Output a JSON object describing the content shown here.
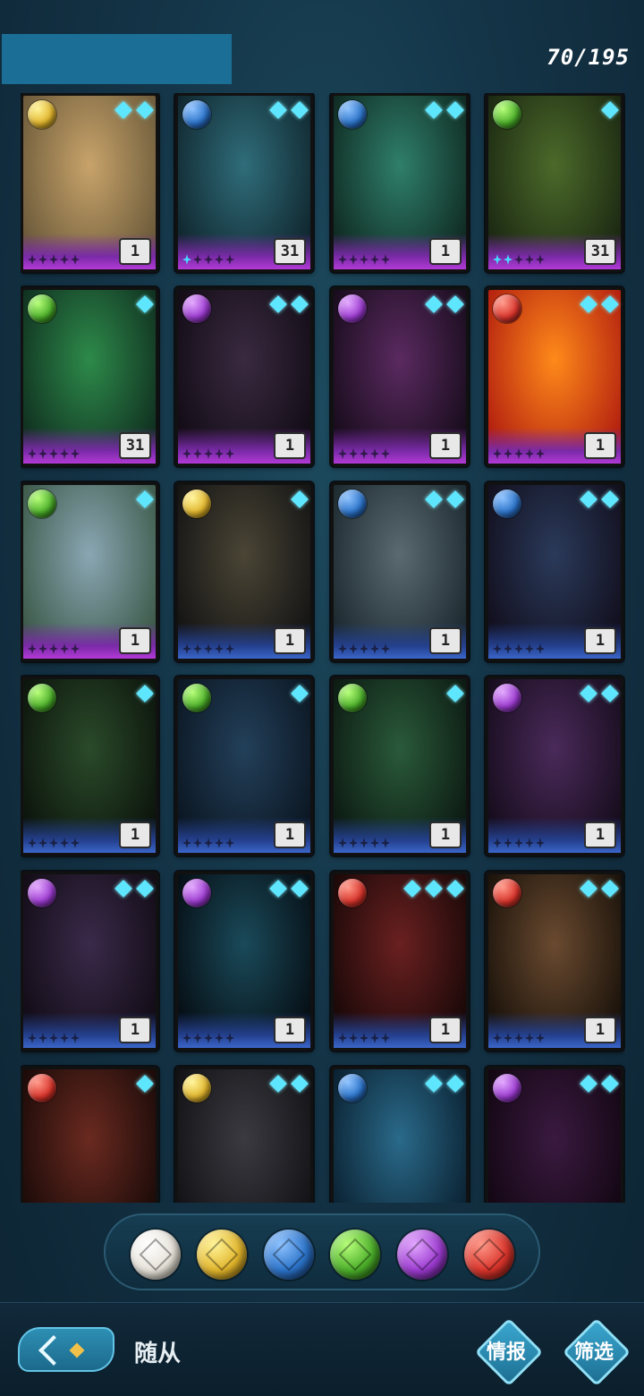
{
  "header": {
    "counter": "70/195"
  },
  "cards": [
    {
      "element": "light",
      "diamonds": 2,
      "count": "1",
      "stars_lit": 0,
      "rarity": "purple",
      "art": [
        "#c8a36a",
        "#6b5a3a"
      ]
    },
    {
      "element": "water",
      "diamonds": 2,
      "count": "31",
      "stars_lit": 1,
      "rarity": "purple",
      "art": [
        "#2f6d7a",
        "#10262e"
      ]
    },
    {
      "element": "water",
      "diamonds": 2,
      "count": "1",
      "stars_lit": 0,
      "rarity": "purple",
      "art": [
        "#2f7f6b",
        "#0f2a22"
      ]
    },
    {
      "element": "nature",
      "diamonds": 1,
      "count": "31",
      "stars_lit": 2,
      "rarity": "purple",
      "art": [
        "#4c6a2a",
        "#1b2812"
      ]
    },
    {
      "element": "nature",
      "diamonds": 1,
      "count": "31",
      "stars_lit": 0,
      "rarity": "purple",
      "art": [
        "#2d8a4a",
        "#103020"
      ]
    },
    {
      "element": "dark",
      "diamonds": 2,
      "count": "1",
      "stars_lit": 0,
      "rarity": "purple",
      "art": [
        "#3a2a40",
        "#120c16"
      ]
    },
    {
      "element": "dark",
      "diamonds": 2,
      "count": "1",
      "stars_lit": 0,
      "rarity": "purple",
      "art": [
        "#5a2a60",
        "#180c1c"
      ]
    },
    {
      "element": "fire",
      "diamonds": 2,
      "count": "1",
      "stars_lit": 0,
      "rarity": "purple",
      "art": [
        "#ff8a1a",
        "#b3200f"
      ]
    },
    {
      "element": "nature",
      "diamonds": 1,
      "count": "1",
      "stars_lit": 0,
      "rarity": "purple",
      "art": [
        "#8aa6b3",
        "#3d5a4a"
      ]
    },
    {
      "element": "light",
      "diamonds": 1,
      "count": "1",
      "stars_lit": 0,
      "rarity": "blue",
      "art": [
        "#4a4535",
        "#141414"
      ]
    },
    {
      "element": "water",
      "diamonds": 2,
      "count": "1",
      "stars_lit": 0,
      "rarity": "blue",
      "art": [
        "#5a6a70",
        "#1c2a30"
      ]
    },
    {
      "element": "water",
      "diamonds": 2,
      "count": "1",
      "stars_lit": 0,
      "rarity": "blue",
      "art": [
        "#2a3a5a",
        "#120f1e"
      ]
    },
    {
      "element": "nature",
      "diamonds": 1,
      "count": "1",
      "stars_lit": 0,
      "rarity": "blue",
      "art": [
        "#2a4a2a",
        "#0c140c"
      ]
    },
    {
      "element": "nature",
      "diamonds": 1,
      "count": "1",
      "stars_lit": 0,
      "rarity": "blue",
      "art": [
        "#23405a",
        "#0b1622"
      ]
    },
    {
      "element": "nature",
      "diamonds": 1,
      "count": "1",
      "stars_lit": 0,
      "rarity": "blue",
      "art": [
        "#2a5a3a",
        "#0c1a12"
      ]
    },
    {
      "element": "dark",
      "diamonds": 2,
      "count": "1",
      "stars_lit": 0,
      "rarity": "blue",
      "art": [
        "#4a2a5a",
        "#160c1c"
      ]
    },
    {
      "element": "dark",
      "diamonds": 2,
      "count": "1",
      "stars_lit": 0,
      "rarity": "blue",
      "art": [
        "#3a2a4a",
        "#120c16"
      ]
    },
    {
      "element": "dark",
      "diamonds": 2,
      "count": "1",
      "stars_lit": 0,
      "rarity": "blue",
      "art": [
        "#1a4a5a",
        "#060e14"
      ]
    },
    {
      "element": "fire",
      "diamonds": 3,
      "count": "1",
      "stars_lit": 0,
      "rarity": "blue",
      "art": [
        "#6a2020",
        "#1a0808"
      ]
    },
    {
      "element": "fire",
      "diamonds": 2,
      "count": "1",
      "stars_lit": 0,
      "rarity": "blue",
      "art": [
        "#6a4a30",
        "#1a120a"
      ]
    },
    {
      "element": "fire",
      "diamonds": 1,
      "count": "",
      "stars_lit": 0,
      "rarity": "none",
      "art": [
        "#6a2a20",
        "#1a0a08"
      ]
    },
    {
      "element": "light",
      "diamonds": 2,
      "count": "",
      "stars_lit": 0,
      "rarity": "none",
      "art": [
        "#3a3a40",
        "#121216"
      ]
    },
    {
      "element": "water",
      "diamonds": 2,
      "count": "",
      "stars_lit": 0,
      "rarity": "none",
      "art": [
        "#2a6a8a",
        "#0a2030"
      ]
    },
    {
      "element": "dark",
      "diamonds": 2,
      "count": "",
      "stars_lit": 0,
      "rarity": "none",
      "art": [
        "#3a1a40",
        "#120612"
      ]
    }
  ],
  "filters": [
    {
      "name": "all",
      "orb": "neutral"
    },
    {
      "name": "light",
      "orb": "light"
    },
    {
      "name": "water",
      "orb": "water"
    },
    {
      "name": "nature",
      "orb": "nature"
    },
    {
      "name": "dark",
      "orb": "dark"
    },
    {
      "name": "fire",
      "orb": "fire"
    }
  ],
  "bottom": {
    "title": "随从",
    "intel_label": "情报",
    "filter_label": "筛选"
  },
  "colors": {
    "accent": "#5fe6ff",
    "banner": "#1b6f96"
  }
}
